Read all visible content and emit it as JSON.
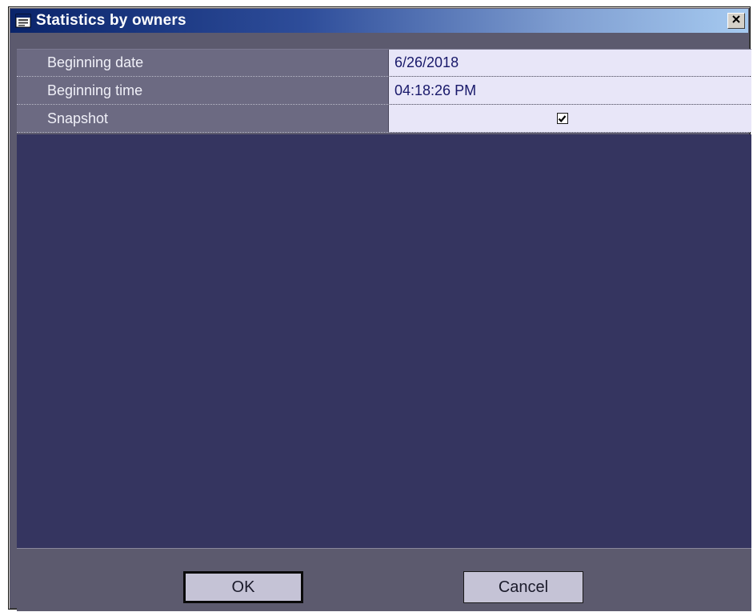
{
  "window": {
    "title": "Statistics by owners",
    "icon": "window-app-icon",
    "close_icon": "close-icon"
  },
  "properties": {
    "rows": [
      {
        "label": "Beginning date",
        "value": "6/26/2018"
      },
      {
        "label": "Beginning time",
        "value": "04:18:26 PM"
      },
      {
        "label": "Snapshot",
        "checked": true
      }
    ]
  },
  "buttons": {
    "ok_label": "OK",
    "cancel_label": "Cancel"
  },
  "colors": {
    "title_gradient_start": "#0a246a",
    "title_gradient_end": "#a6caf0",
    "panel_background": "#353560",
    "label_background": "#6c6a82",
    "value_background": "#e8e6f8",
    "value_text": "#18186a"
  }
}
